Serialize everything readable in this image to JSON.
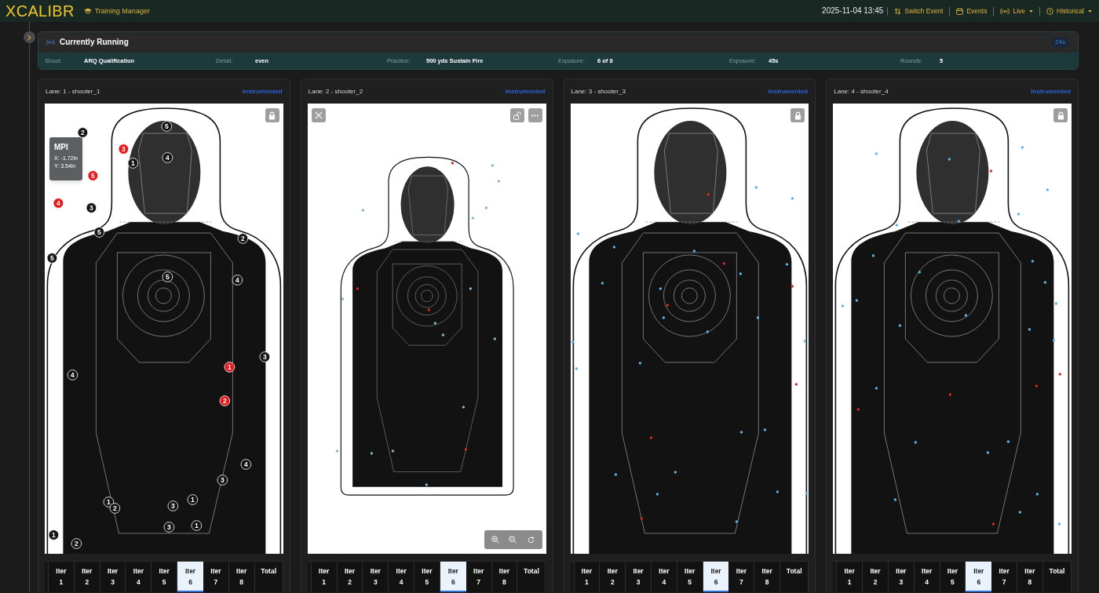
{
  "header": {
    "logo": "XCALIBR",
    "module": "Training Manager",
    "datetime": "2025-11-04 13:45",
    "nav": [
      {
        "label": "Switch Event",
        "dropdown": false
      },
      {
        "label": "Events",
        "dropdown": false
      },
      {
        "label": "Live",
        "dropdown": true
      },
      {
        "label": "Historical",
        "dropdown": true
      }
    ]
  },
  "sidebar": {
    "collapsed": true
  },
  "running": {
    "title": "Currently Running",
    "timer": "24s",
    "fields": [
      {
        "label": "Shoot:",
        "value": "ARQ Qualification"
      },
      {
        "label": "Detail:",
        "value": "even"
      },
      {
        "label": "Practice:",
        "value": "500 yds Sustain Fire"
      },
      {
        "label": "Exposure:",
        "value": "6 of 8"
      },
      {
        "label": "Exposure:",
        "value": "45s"
      },
      {
        "label": "Rounds:",
        "value": "5"
      }
    ]
  },
  "lanes": [
    {
      "title": "Lane: 1 - shooter_1",
      "mode": "Instrumented",
      "locked": true,
      "controls_shown": false,
      "zoomed_out": false,
      "mpi": {
        "title": "MPI",
        "lines": [
          "X: -1.72in",
          "Y: 3.54in"
        ]
      },
      "shots": [
        {
          "label": "2",
          "color": "#141414"
        },
        {
          "label": "5",
          "color": "#141414"
        },
        {
          "label": "3",
          "color": "#e31b1b"
        },
        {
          "label": "1",
          "color": "#141414"
        },
        {
          "label": "4",
          "color": "#141414"
        },
        {
          "label": "5",
          "color": "#e31b1b"
        },
        {
          "label": "4",
          "color": "#e31b1b"
        },
        {
          "label": "3",
          "color": "#141414"
        },
        {
          "label": "5",
          "color": "#141414"
        },
        {
          "label": "2",
          "color": "#141414"
        },
        {
          "label": "5",
          "color": "#141414"
        },
        {
          "label": "5",
          "color": "#141414"
        },
        {
          "label": "4",
          "color": "#141414"
        },
        {
          "label": "3",
          "color": "#141414"
        },
        {
          "label": "1",
          "color": "#e31b1b"
        },
        {
          "label": "4",
          "color": "#141414"
        },
        {
          "label": "2",
          "color": "#e31b1b"
        },
        {
          "label": "4",
          "color": "#141414"
        },
        {
          "label": "3",
          "color": "#141414"
        },
        {
          "label": "1",
          "color": "#141414"
        },
        {
          "label": "1",
          "color": "#141414"
        },
        {
          "label": "2",
          "color": "#141414"
        },
        {
          "label": "3",
          "color": "#141414"
        },
        {
          "label": "3",
          "color": "#141414"
        },
        {
          "label": "1",
          "color": "#141414"
        },
        {
          "label": "1",
          "color": "#141414"
        },
        {
          "label": "2",
          "color": "#141414"
        }
      ],
      "columns": [
        {
          "label": "Iter 1",
          "selected": false
        },
        {
          "label": "Iter 2",
          "selected": false
        },
        {
          "label": "Iter 3",
          "selected": false
        },
        {
          "label": "Iter 4",
          "selected": false
        },
        {
          "label": "Iter 5",
          "selected": false
        },
        {
          "label": "Iter 6",
          "selected": true
        },
        {
          "label": "Iter 7",
          "selected": false
        },
        {
          "label": "Iter 8",
          "selected": false
        },
        {
          "label": "Total",
          "selected": false
        }
      ]
    },
    {
      "title": "Lane: 2 - shooter_2",
      "mode": "Instrumented",
      "locked": false,
      "controls_shown": true,
      "zoomed_out": true,
      "shots": [
        {
          "color": "#86b5d0"
        },
        {
          "color": "#86b5d0"
        },
        {
          "color": "#86b5d0"
        },
        {
          "color": "#86b5d0"
        },
        {
          "color": "#86b5d0"
        },
        {
          "color": "#86b5d0"
        },
        {
          "color": "#86b5d0"
        },
        {
          "color": "#86b5d0"
        },
        {
          "color": "#86b5d0"
        },
        {
          "color": "#86b5d0"
        },
        {
          "color": "#86b5d0"
        },
        {
          "color": "#86b5d0"
        },
        {
          "color": "#86b5d0"
        },
        {
          "color": "#86b5d0"
        },
        {
          "color": "#86b5d0"
        },
        {
          "color": "#d62828"
        },
        {
          "color": "#d62828"
        },
        {
          "color": "#d62828"
        },
        {
          "color": "#d62828"
        }
      ],
      "columns": [
        {
          "label": "Iter 1",
          "selected": false
        },
        {
          "label": "Iter 2",
          "selected": false
        },
        {
          "label": "Iter 3",
          "selected": false
        },
        {
          "label": "Iter 4",
          "selected": false
        },
        {
          "label": "Iter 5",
          "selected": false
        },
        {
          "label": "Iter 6",
          "selected": true
        },
        {
          "label": "Iter 7",
          "selected": false
        },
        {
          "label": "Iter 8",
          "selected": false
        },
        {
          "label": "Total",
          "selected": false
        }
      ]
    },
    {
      "title": "Lane: 3 - shooter_3",
      "mode": "Instrumented",
      "locked": true,
      "controls_shown": false,
      "zoomed_out": false,
      "shots": [
        {
          "color": "#5fb2e2"
        },
        {
          "color": "#5fb2e2"
        },
        {
          "color": "#5fb2e2"
        },
        {
          "color": "#5fb2e2"
        },
        {
          "color": "#5fb2e2"
        },
        {
          "color": "#5fb2e2"
        },
        {
          "color": "#5fb2e2"
        },
        {
          "color": "#5fb2e2"
        },
        {
          "color": "#5fb2e2"
        },
        {
          "color": "#5fb2e2"
        },
        {
          "color": "#5fb2e2"
        },
        {
          "color": "#5fb2e2"
        },
        {
          "color": "#5fb2e2"
        },
        {
          "color": "#5fb2e2"
        },
        {
          "color": "#5fb2e2"
        },
        {
          "color": "#5fb2e2"
        },
        {
          "color": "#5fb2e2"
        },
        {
          "color": "#5fb2e2"
        },
        {
          "color": "#5fb2e2"
        },
        {
          "color": "#5fb2e2"
        },
        {
          "color": "#5fb2e2"
        },
        {
          "color": "#5fb2e2"
        },
        {
          "color": "#5fb2e2"
        },
        {
          "color": "#5fb2e2"
        },
        {
          "color": "#d62828"
        },
        {
          "color": "#d62828"
        },
        {
          "color": "#d62828"
        },
        {
          "color": "#d62828"
        },
        {
          "color": "#d62828"
        },
        {
          "color": "#d62828"
        },
        {
          "color": "#d62828"
        }
      ],
      "columns": [
        {
          "label": "Iter 1",
          "selected": false
        },
        {
          "label": "Iter 2",
          "selected": false
        },
        {
          "label": "Iter 3",
          "selected": false
        },
        {
          "label": "Iter 4",
          "selected": false
        },
        {
          "label": "Iter 5",
          "selected": false
        },
        {
          "label": "Iter 6",
          "selected": true
        },
        {
          "label": "Iter 7",
          "selected": false
        },
        {
          "label": "Iter 8",
          "selected": false
        },
        {
          "label": "Total",
          "selected": false
        }
      ]
    },
    {
      "title": "Lane: 4 - shooter_4",
      "mode": "Instrumented",
      "locked": true,
      "controls_shown": false,
      "zoomed_out": false,
      "shots": [
        {
          "color": "#5fb2e2"
        },
        {
          "color": "#5fb2e2"
        },
        {
          "color": "#5fb2e2"
        },
        {
          "color": "#5fb2e2"
        },
        {
          "color": "#5fb2e2"
        },
        {
          "color": "#5fb2e2"
        },
        {
          "color": "#5fb2e2"
        },
        {
          "color": "#5fb2e2"
        },
        {
          "color": "#5fb2e2"
        },
        {
          "color": "#5fb2e2"
        },
        {
          "color": "#5fb2e2"
        },
        {
          "color": "#5fb2e2"
        },
        {
          "color": "#5fb2e2"
        },
        {
          "color": "#5fb2e2"
        },
        {
          "color": "#5fb2e2"
        },
        {
          "color": "#5fb2e2"
        },
        {
          "color": "#5fb2e2"
        },
        {
          "color": "#5fb2e2"
        },
        {
          "color": "#5fb2e2"
        },
        {
          "color": "#5fb2e2"
        },
        {
          "color": "#5fb2e2"
        },
        {
          "color": "#5fb2e2"
        },
        {
          "color": "#5fb2e2"
        },
        {
          "color": "#5fb2e2"
        },
        {
          "color": "#5fb2e2"
        },
        {
          "color": "#5fb2e2"
        },
        {
          "color": "#d62828"
        },
        {
          "color": "#d62828"
        },
        {
          "color": "#d62828"
        },
        {
          "color": "#d62828"
        },
        {
          "color": "#d62828"
        },
        {
          "color": "#d62828"
        }
      ],
      "columns": [
        {
          "label": "Iter 1",
          "selected": false
        },
        {
          "label": "Iter 2",
          "selected": false
        },
        {
          "label": "Iter 3",
          "selected": false
        },
        {
          "label": "Iter 4",
          "selected": false
        },
        {
          "label": "Iter 5",
          "selected": false
        },
        {
          "label": "Iter 6",
          "selected": true
        },
        {
          "label": "Iter 7",
          "selected": false
        },
        {
          "label": "Iter 8",
          "selected": false
        },
        {
          "label": "Total",
          "selected": false
        }
      ]
    }
  ]
}
